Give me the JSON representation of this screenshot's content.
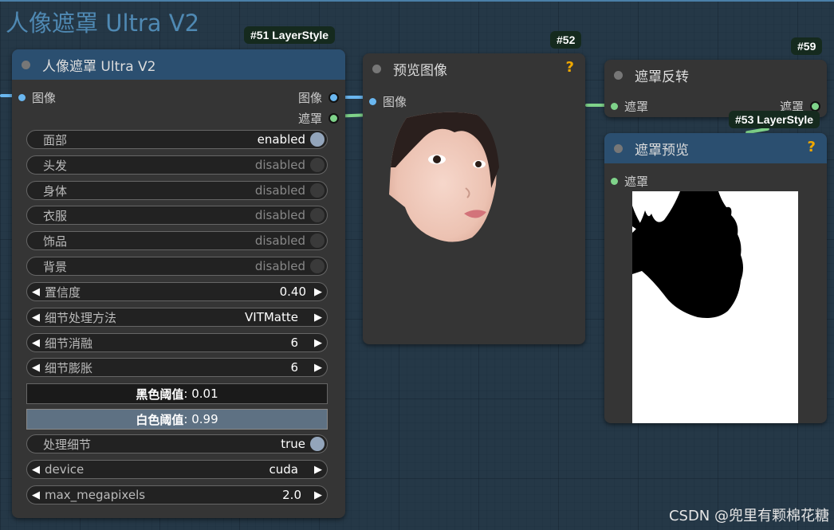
{
  "group": {
    "title": "人像遮罩 Ultra V2"
  },
  "badges": {
    "n51": "#51 LayerStyle",
    "n52": "#52",
    "n59": "#59",
    "n53": "#53 LayerStyle"
  },
  "node51": {
    "title": "人像遮罩 Ultra V2",
    "input_image": "图像",
    "output_image": "图像",
    "output_mask": "遮罩",
    "toggles": [
      {
        "label": "面部",
        "value": "enabled"
      },
      {
        "label": "头发",
        "value": "disabled"
      },
      {
        "label": "身体",
        "value": "disabled"
      },
      {
        "label": "衣服",
        "value": "disabled"
      },
      {
        "label": "饰品",
        "value": "disabled"
      },
      {
        "label": "背景",
        "value": "disabled"
      }
    ],
    "steppers": [
      {
        "label": "置信度",
        "value": "0.40"
      },
      {
        "label": "细节处理方法",
        "value": "VITMatte"
      },
      {
        "label": "细节消融",
        "value": "6"
      },
      {
        "label": "细节膨胀",
        "value": "6"
      }
    ],
    "black_threshold": {
      "label": "黑色阈值",
      "value": ": 0.01"
    },
    "white_threshold": {
      "label": "白色阈值",
      "value": ": 0.99"
    },
    "process_detail": {
      "label": "处理细节",
      "value": "true"
    },
    "device": {
      "label": "device",
      "value": "cuda"
    },
    "max_megapixels": {
      "label": "max_megapixels",
      "value": "2.0"
    }
  },
  "node52": {
    "title": "预览图像",
    "input_image": "图像",
    "help": "?"
  },
  "node59": {
    "title": "遮罩反转",
    "input_mask": "遮罩",
    "output_mask": "遮罩"
  },
  "node53": {
    "title": "遮罩预览",
    "input_mask": "遮罩",
    "help": "?"
  },
  "watermark": "CSDN @兜里有颗棉花糖",
  "colors": {
    "node_header": "#2b4f70",
    "node_body": "#353535",
    "image_slot": "#6ab7f0",
    "mask_slot": "#7fd38a",
    "help": "#f0a800"
  }
}
